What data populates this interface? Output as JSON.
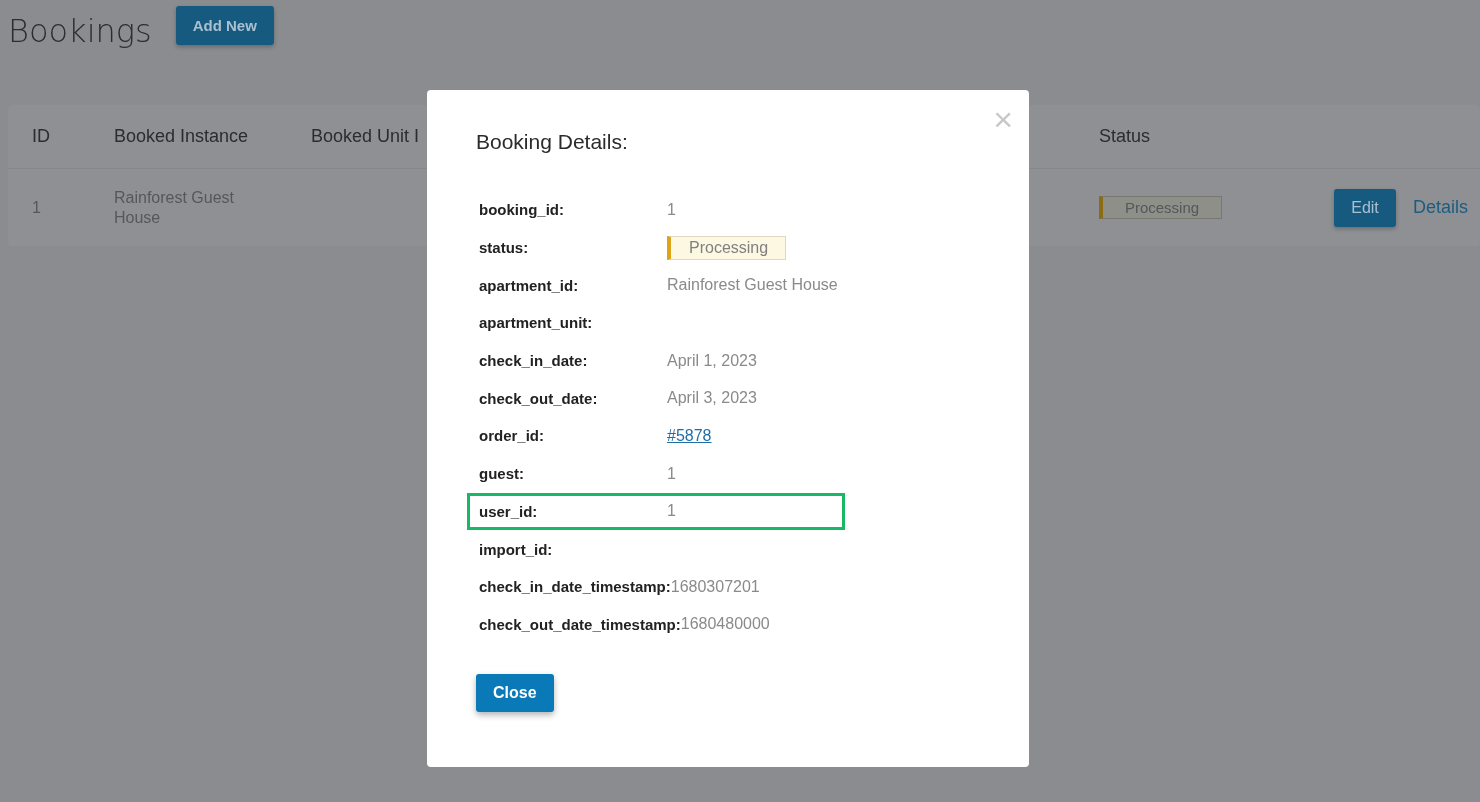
{
  "page": {
    "title": "Bookings",
    "add_button": "Add New"
  },
  "table": {
    "columns": [
      "ID",
      "Booked Instance",
      "Booked Unit I"
    ],
    "status_column": "Status",
    "rows": [
      {
        "id": "1",
        "instance": "Rainforest Guest House",
        "status": "Processing",
        "edit": "Edit",
        "details": "Details"
      }
    ]
  },
  "modal": {
    "title": "Booking Details:",
    "close_icon": "×",
    "close_button": "Close",
    "fields": [
      {
        "label": "booking_id:",
        "kind": "text",
        "value": "1",
        "highlighted": false
      },
      {
        "label": "status:",
        "kind": "status",
        "value": "Processing",
        "highlighted": false
      },
      {
        "label": "apartment_id:",
        "kind": "text",
        "value": "Rainforest Guest House",
        "highlighted": false
      },
      {
        "label": "apartment_unit:",
        "kind": "empty",
        "highlighted": false
      },
      {
        "label": "check_in_date:",
        "kind": "text",
        "value": "April 1, 2023",
        "highlighted": false
      },
      {
        "label": "check_out_date:",
        "kind": "text",
        "value": "April 3, 2023",
        "highlighted": false
      },
      {
        "label": "order_id:",
        "kind": "link",
        "value": "#5878",
        "highlighted": false
      },
      {
        "label": "guest:",
        "kind": "text",
        "value": "1",
        "highlighted": false
      },
      {
        "label": "user_id:",
        "kind": "text",
        "value": "1",
        "highlighted": true
      },
      {
        "label": "import_id:",
        "kind": "empty",
        "highlighted": false
      },
      {
        "label": "check_in_date_timestamp:",
        "kind": "text",
        "value": "1680307201",
        "highlighted": false
      },
      {
        "label": "check_out_date_timestamp:",
        "kind": "text",
        "value": "1680480000",
        "highlighted": false
      }
    ]
  }
}
